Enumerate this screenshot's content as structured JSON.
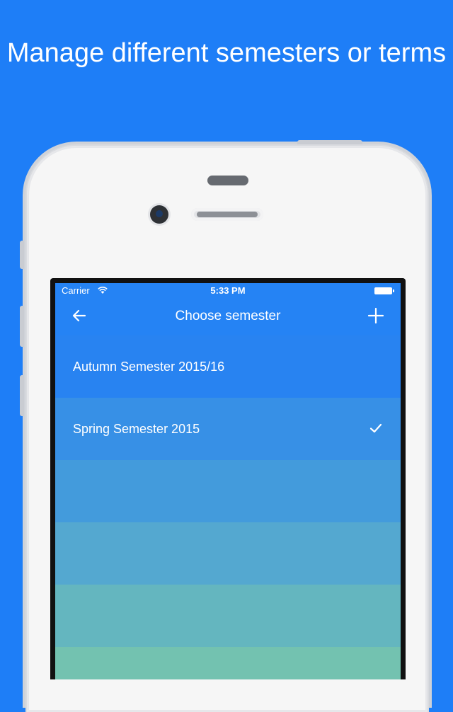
{
  "headline": "Manage different semesters or terms",
  "status_bar": {
    "carrier": "Carrier",
    "time": "5:33 PM",
    "icons": [
      "wifi-icon",
      "battery-icon"
    ]
  },
  "nav": {
    "title": "Choose semester",
    "back_icon": "arrow-left-icon",
    "add_icon": "plus-icon"
  },
  "semesters": [
    {
      "label": "Autumn Semester 2015/16",
      "selected": false
    },
    {
      "label": "Spring Semester 2015",
      "selected": true
    }
  ],
  "colors": {
    "background": "#1e7ef7",
    "row_colors": [
      "#2883f1",
      "#3790e6",
      "#439bdc",
      "#54a8d0",
      "#64b6bf",
      "#73c2b0"
    ]
  }
}
